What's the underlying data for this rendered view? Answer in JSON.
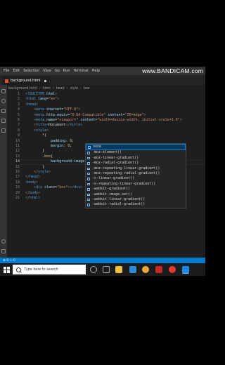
{
  "menubar": {
    "items": [
      "File",
      "Edit",
      "Selection",
      "View",
      "Go",
      "Run",
      "Terminal",
      "Help"
    ]
  },
  "watermark": "www.BANDICAM.com",
  "tab": {
    "label": "background.html"
  },
  "breadcrumbs": [
    "background.html",
    "html",
    "head",
    "style",
    "box"
  ],
  "code_lines": [
    {
      "n": "1",
      "html": "<span class='pun'>&lt;</span><span class='tag'>!DOCTYPE</span> <span class='attr'>html</span><span class='pun'>&gt;</span>"
    },
    {
      "n": "2",
      "html": "<span class='pun'>&lt;</span><span class='tag'>html</span> <span class='attr'>lang</span><span class='txt'>=</span><span class='str'>\"en\"</span><span class='pun'>&gt;</span>"
    },
    {
      "n": "3",
      "html": "<span class='pun'>&lt;</span><span class='tag'>head</span><span class='pun'>&gt;</span>"
    },
    {
      "n": "4",
      "html": "    <span class='pun'>&lt;</span><span class='tag'>meta</span> <span class='attr'>charset</span><span class='txt'>=</span><span class='str'>\"UTF-8\"</span><span class='pun'>&gt;</span>"
    },
    {
      "n": "5",
      "html": "    <span class='pun'>&lt;</span><span class='tag'>meta</span> <span class='attr'>http-equiv</span><span class='txt'>=</span><span class='str'>\"X-UA-Compatible\"</span> <span class='attr'>content</span><span class='txt'>=</span><span class='str'>\"IE=edge\"</span><span class='pun'>&gt;</span>"
    },
    {
      "n": "6",
      "html": "    <span class='pun'>&lt;</span><span class='tag'>meta</span> <span class='attr'>name</span><span class='txt'>=</span><span class='str'>\"viewport\"</span> <span class='attr'>content</span><span class='txt'>=</span><span class='str'>\"width=device-width, initial-scale=1.0\"</span><span class='pun'>&gt;</span>"
    },
    {
      "n": "7",
      "html": "    <span class='pun'>&lt;</span><span class='tag'>title</span><span class='pun'>&gt;</span><span class='txt'>Document</span><span class='pun'>&lt;/</span><span class='tag'>title</span><span class='pun'>&gt;</span>"
    },
    {
      "n": "8",
      "html": "    <span class='pun'>&lt;</span><span class='tag'>style</span><span class='pun'>&gt;</span>"
    },
    {
      "n": "9",
      "html": "        <span class='sel'>*</span><span class='txt'>{</span>"
    },
    {
      "n": "10",
      "html": "            <span class='prop'>padding</span><span class='txt'>: </span><span class='num'>0</span><span class='txt'>;</span>"
    },
    {
      "n": "11",
      "html": "            <span class='prop'>margin</span><span class='txt'>: </span><span class='num'>0</span><span class='txt'>;</span>"
    },
    {
      "n": "12",
      "html": "        <span class='txt'>}</span>"
    },
    {
      "n": "13",
      "html": "        <span class='sel'>.box</span><span class='txt'>{</span>"
    },
    {
      "n": "14",
      "html": "            <span class='prop'>background-image</span><span class='txt'>: ;</span>"
    },
    {
      "n": "15",
      "html": "        <span class='txt'>}</span>"
    },
    {
      "n": "16",
      "html": "    <span class='pun'>&lt;/</span><span class='tag'>style</span><span class='pun'>&gt;</span>"
    },
    {
      "n": "17",
      "html": "<span class='pun'>&lt;/</span><span class='tag'>head</span><span class='pun'>&gt;</span>"
    },
    {
      "n": "18",
      "html": "<span class='pun'>&lt;</span><span class='tag'>body</span><span class='pun'>&gt;</span>"
    },
    {
      "n": "19",
      "html": "    <span class='pun'>&lt;</span><span class='tag'>div</span> <span class='attr'>class</span><span class='txt'>=</span><span class='str'>\"box\"</span><span class='pun'>&gt;&lt;/</span><span class='tag'>div</span><span class='pun'>&gt;</span>"
    },
    {
      "n": "20",
      "html": "<span class='pun'>&lt;/</span><span class='tag'>body</span><span class='pun'>&gt;</span>"
    },
    {
      "n": "21",
      "html": "<span class='pun'>&lt;/</span><span class='tag'>html</span><span class='pun'>&gt;</span>"
    }
  ],
  "active_line": "14",
  "suggestions": [
    "none",
    "-moz-element()",
    "-moz-linear-gradient()",
    "-moz-radial-gradient()",
    "-moz-repeating-linear-gradient()",
    "-moz-repeating-radial-gradient()",
    "-o-linear-gradient()",
    "-o-repeating-linear-gradient()",
    "-webkit-gradient()",
    "-webkit-image-set()",
    "-webkit-linear-gradient()",
    "-webkit-radial-gradient()"
  ],
  "statusbar": {
    "problems": "⊗ 0 ⚠ 0"
  },
  "taskbar": {
    "search_placeholder": "Type here to search"
  },
  "colors": {
    "accent": "#007acc",
    "editor_bg": "#1e1e1e"
  }
}
